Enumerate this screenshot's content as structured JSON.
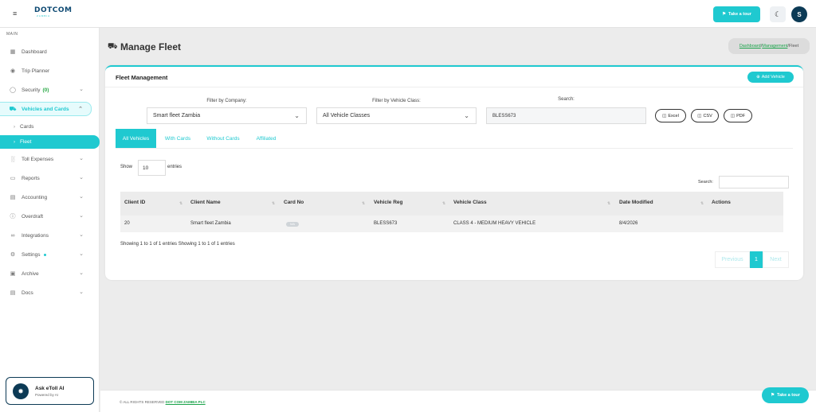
{
  "topbar": {
    "menu_icon": "hamburger-icon",
    "logo_text": "DOTCOM",
    "logo_sub": "ZAMBIA",
    "tour_label": "Take a tour",
    "theme_icon": "moon-icon",
    "avatar_initial": "S"
  },
  "sidebar": {
    "section": "MAIN",
    "items": [
      {
        "label": "Dashboard",
        "icon": "dashboard-icon"
      },
      {
        "label": "Trip Planner",
        "icon": "map-pin-icon"
      },
      {
        "label": "Security",
        "badge": "(0)",
        "icon": "shield-icon"
      },
      {
        "label": "Vehicles and Cards",
        "icon": "truck-icon"
      },
      {
        "label": "Toll Expenses",
        "icon": "bar-chart-icon"
      },
      {
        "label": "Reports",
        "icon": "file-icon"
      },
      {
        "label": "Accounting",
        "icon": "book-icon"
      },
      {
        "label": "Overdraft",
        "icon": "alert-icon"
      },
      {
        "label": "Integrations",
        "icon": "link-icon"
      },
      {
        "label": "Settings",
        "icon": "gear-icon"
      },
      {
        "label": "Archive",
        "icon": "archive-icon"
      },
      {
        "label": "Docs",
        "icon": "docs-icon"
      }
    ],
    "subitems": [
      {
        "label": "Cards"
      },
      {
        "label": "Fleet"
      }
    ],
    "ai_title": "Ask eToll AI",
    "ai_sub": "Powered by AI"
  },
  "page": {
    "title": "Manage Fleet",
    "crumb_dashboard": "Dashboard",
    "crumb_sep1": "/",
    "crumb_management": "Management",
    "crumb_sep2": "/",
    "crumb_current": "Fleet"
  },
  "card": {
    "title": "Fleet Management",
    "add_vehicle": "Add Vehicle",
    "filter_company_label": "Filter by Company:",
    "filter_company_value": "Smart fleet Zambia",
    "filter_class_label": "Filter by Vehicle Class:",
    "filter_class_value": "All Vehicle Classes",
    "search_label": "Search:",
    "search_value": "BLESS673",
    "export": {
      "excel": "Excel",
      "csv": "CSV",
      "pdf": "PDF"
    },
    "tabs": [
      "All Vehicles",
      "With Cards",
      "Without Cards",
      "Affiliated"
    ],
    "show_label": "Show",
    "show_value": "10",
    "entries_label": "entries",
    "table_search_label": "Search:",
    "columns": [
      "Client ID",
      "Client Name",
      "Card No",
      "Vehicle Reg",
      "Vehicle Class",
      "Date Modified",
      "Actions"
    ],
    "rows": [
      {
        "client_id": "20",
        "client_name": "Smart fleet Zambia",
        "card_no": "N/A",
        "vehicle_reg": "BLESS673",
        "vehicle_class": "CLASS 4 - MEDIUM HEAVY VEHICLE",
        "date_modified": "8/4/2026",
        "actions": ""
      }
    ],
    "info": "Showing 1 to 1 of 1 entries Showing 1 to 1 of 1 entries",
    "pager": {
      "prev": "Previous",
      "current": "1",
      "next": "Next"
    }
  },
  "footer": {
    "text": "© ALL RIGHTS RESERVED",
    "company": "DOT COM ZAMBIA PLC"
  },
  "colors": {
    "accent": "#1fc9d0",
    "brand": "#0c3a55",
    "link": "#1aa34a"
  }
}
